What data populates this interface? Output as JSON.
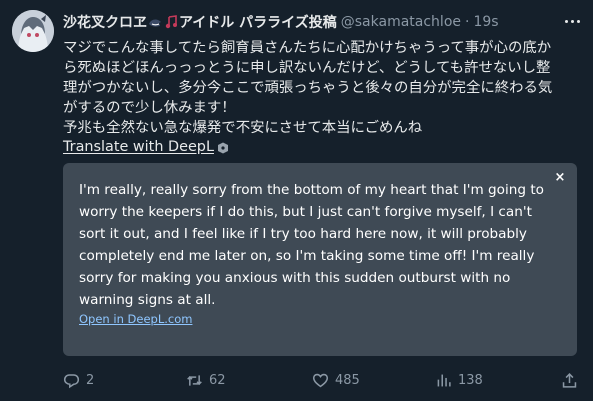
{
  "tweet": {
    "display_name": "沙花叉クロヱ",
    "display_name_suffix": "アイドル パラライズ投稿",
    "handle": "@sakamatachloe",
    "separator": "·",
    "time": "19s",
    "text_lines": [
      "マジでこんな事してたら飼育員さんたちに心配かけちゃうって事が心の底か",
      "ら死ぬほどほんっっっとうに申し訳ないんだけど、どうしても許せないし整",
      "理がつかないし、多分今ここで頑張っちゃうと後々の自分が完全に終わる気",
      "がするので少し休みます！",
      "予兆も全然ない急な爆発で不安にさせて本当にごめんね"
    ],
    "translate_label": "Translate with DeepL"
  },
  "translation": {
    "close_label": "×",
    "text_lines": [
      "I'm really, really sorry from the bottom of my heart that I'm going to",
      "worry the keepers if I do this, but I just can't forgive myself, I can't",
      "sort it out, and I feel like if I try too hard here now, it will probably",
      "completely end me later on, so I'm taking some time off! I'm really",
      "sorry for making you anxious with this sudden outburst with no",
      "warning signs at all."
    ],
    "open_link": "Open in DeepL.com"
  },
  "actions": {
    "replies": "2",
    "retweets": "62",
    "likes": "485",
    "views": "138"
  },
  "colors": {
    "background": "#15202b",
    "card": "#3f4a55",
    "link": "#8fc6ff",
    "muted": "#8b98a5"
  }
}
